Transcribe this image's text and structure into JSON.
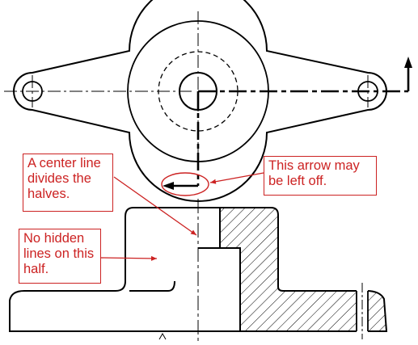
{
  "figure": {
    "colors": {
      "line": "#000000",
      "annotation": "#cc2222",
      "background": "#ffffff"
    }
  },
  "callouts": {
    "center_line": {
      "lines": [
        "A center line",
        "divides the",
        "halves."
      ]
    },
    "no_hidden": {
      "lines": [
        "No hidden",
        "lines on this",
        "half."
      ]
    },
    "arrow_optional": {
      "lines": [
        "This arrow may",
        "be left off."
      ]
    }
  }
}
